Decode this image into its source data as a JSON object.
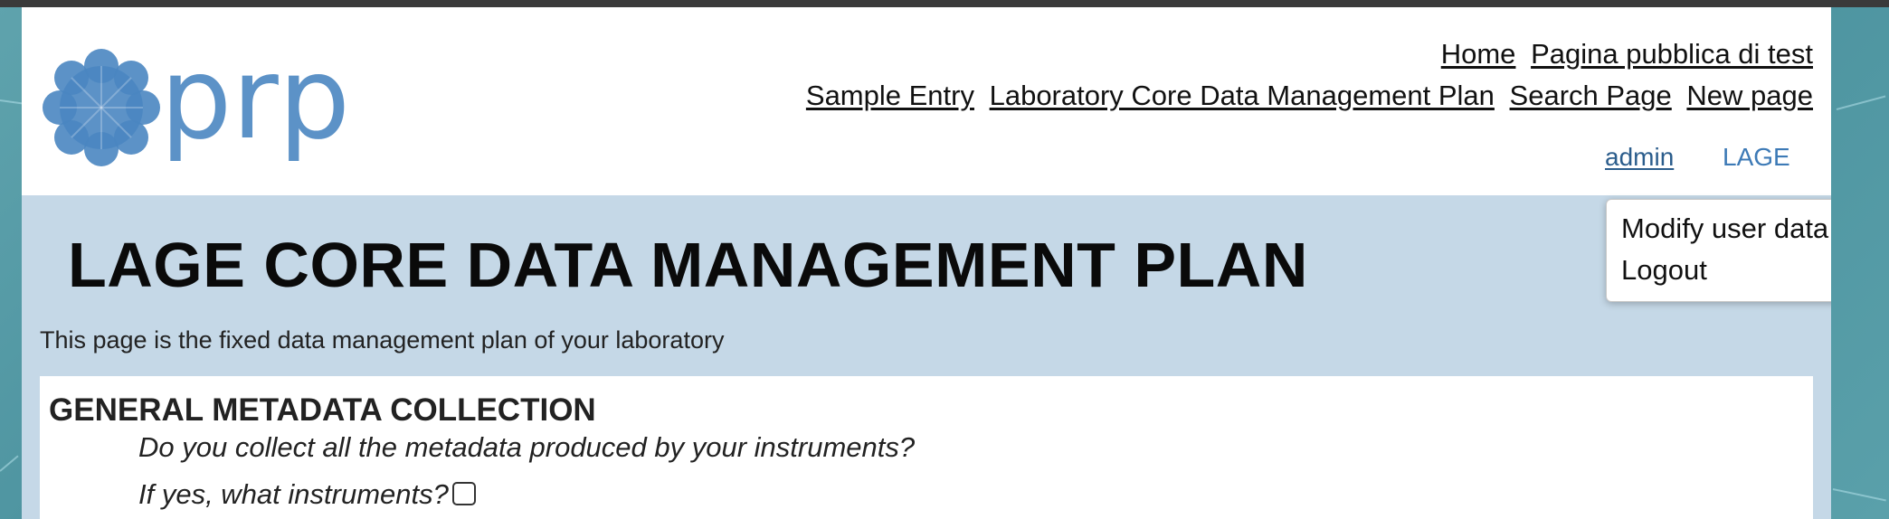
{
  "logo": {
    "text": "prp",
    "color": "#4a86c1"
  },
  "nav": {
    "row1": [
      {
        "label": "Home"
      },
      {
        "label": "Pagina pubblica di test"
      }
    ],
    "row2": [
      {
        "label": "Sample Entry"
      },
      {
        "label": "Laboratory Core Data Management Plan"
      },
      {
        "label": "Search Page"
      },
      {
        "label": "New page"
      }
    ]
  },
  "user": {
    "name": "admin",
    "lab": "LAGE",
    "menu": [
      {
        "label": "Modify user data"
      },
      {
        "label": "Logout"
      }
    ]
  },
  "main": {
    "title": "LAGE CORE DATA MANAGEMENT PLAN",
    "description": "This page is the fixed data management plan of your laboratory",
    "sections": [
      {
        "title": "GENERAL METADATA COLLECTION",
        "questions": [
          {
            "text": "Do you collect all the metadata produced by your instruments?"
          },
          {
            "text": "If yes, what instruments?",
            "checked": false
          }
        ]
      }
    ]
  },
  "colors": {
    "band": "#c5d8e7",
    "link_blue": "#2b5d8c",
    "lab_blue": "#3d7ab6",
    "background_teal": "#4f95a1"
  }
}
